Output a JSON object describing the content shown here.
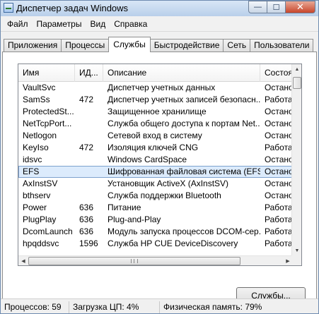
{
  "window": {
    "title": "Диспетчер задач Windows",
    "minimize_glyph": "—",
    "maximize_glyph": "☐",
    "close_glyph": "✕"
  },
  "menu": [
    "Файл",
    "Параметры",
    "Вид",
    "Справка"
  ],
  "tabs": [
    {
      "label": "Приложения",
      "active": false
    },
    {
      "label": "Процессы",
      "active": false
    },
    {
      "label": "Службы",
      "active": true
    },
    {
      "label": "Быстродействие",
      "active": false
    },
    {
      "label": "Сеть",
      "active": false
    },
    {
      "label": "Пользователи",
      "active": false
    }
  ],
  "columns": {
    "name": "Имя",
    "pid": "ИД...",
    "description": "Описание",
    "status": "Состоя"
  },
  "services": [
    {
      "name": "VaultSvc",
      "pid": "",
      "description": "Диспетчер учетных данных",
      "status": "Остано"
    },
    {
      "name": "SamSs",
      "pid": "472",
      "description": "Диспетчер учетных записей безопасн...",
      "status": "Работае"
    },
    {
      "name": "ProtectedSt...",
      "pid": "",
      "description": "Защищенное хранилище",
      "status": "Остано"
    },
    {
      "name": "NetTcpPort...",
      "pid": "",
      "description": "Служба общего доступа к портам Net...",
      "status": "Остано"
    },
    {
      "name": "Netlogon",
      "pid": "",
      "description": "Сетевой вход в систему",
      "status": "Остано"
    },
    {
      "name": "KeyIso",
      "pid": "472",
      "description": "Изоляция ключей CNG",
      "status": "Работае"
    },
    {
      "name": "idsvc",
      "pid": "",
      "description": "Windows CardSpace",
      "status": "Остано"
    },
    {
      "name": "EFS",
      "pid": "",
      "description": "Шифрованная файловая система (EFS)",
      "status": "Остано",
      "selected": true
    },
    {
      "name": "AxInstSV",
      "pid": "",
      "description": "Установщик ActiveX (AxInstSV)",
      "status": "Остано"
    },
    {
      "name": "bthserv",
      "pid": "",
      "description": "Служба поддержки Bluetooth",
      "status": "Остано"
    },
    {
      "name": "Power",
      "pid": "636",
      "description": "Питание",
      "status": "Работае"
    },
    {
      "name": "PlugPlay",
      "pid": "636",
      "description": "Plug-and-Play",
      "status": "Работае"
    },
    {
      "name": "DcomLaunch",
      "pid": "636",
      "description": "Модуль запуска процессов DCOM-сер...",
      "status": "Работае"
    },
    {
      "name": "hpqddsvc",
      "pid": "1596",
      "description": "Служба HP CUE DeviceDiscovery",
      "status": "Работае"
    }
  ],
  "services_button": "Службы...",
  "status": {
    "processes": "Процессов: 59",
    "cpu": "Загрузка ЦП: 4%",
    "memory": "Физическая память: 79%"
  }
}
